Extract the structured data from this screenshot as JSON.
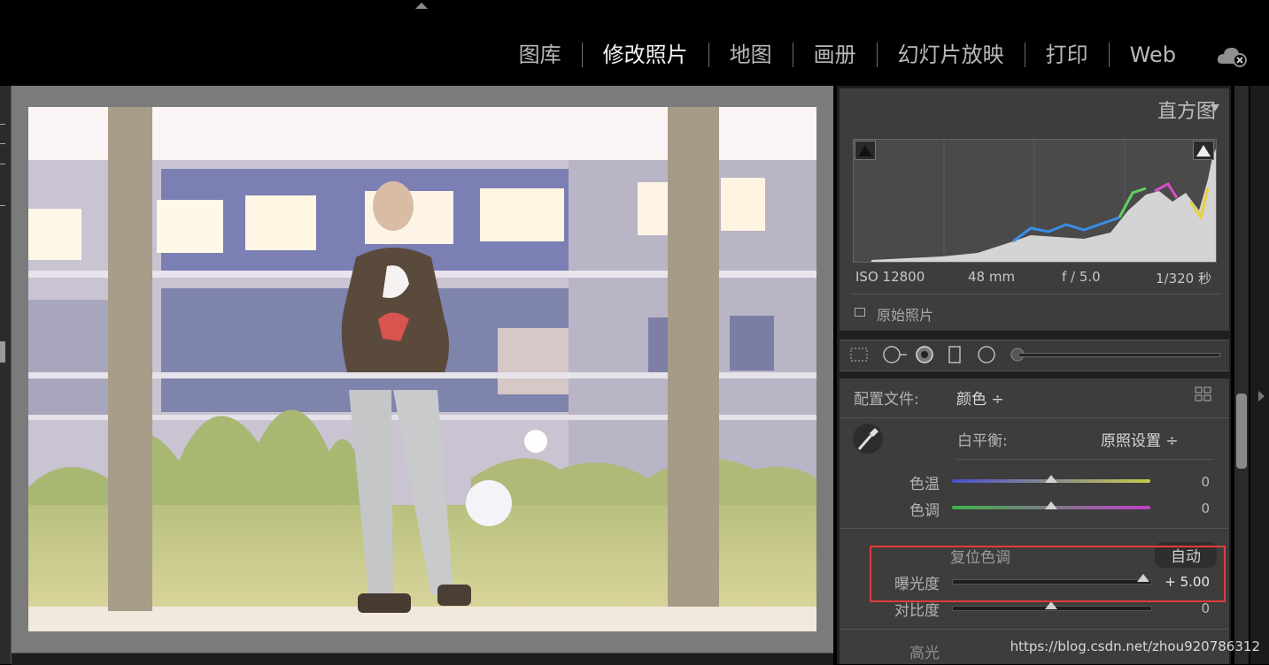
{
  "modules": [
    {
      "label": "图库",
      "active": false
    },
    {
      "label": "修改照片",
      "active": true
    },
    {
      "label": "地图",
      "active": false
    },
    {
      "label": "画册",
      "active": false
    },
    {
      "label": "幻灯片放映",
      "active": false
    },
    {
      "label": "打印",
      "active": false
    },
    {
      "label": "Web",
      "active": false
    }
  ],
  "histogram": {
    "title": "直方图",
    "iso": "ISO 12800",
    "focal": "48 mm",
    "aperture": "f / 5.0",
    "shutter": "1/320 秒",
    "original_label": "原始照片"
  },
  "basic": {
    "profile_label": "配置文件:",
    "profile_value": "颜色 ÷",
    "wb_label": "白平衡:",
    "wb_value": "原照设置 ÷",
    "temp_label": "色温",
    "temp_value": "0",
    "temp_level": 0.5,
    "tint_label": "色调",
    "tint_value": "0",
    "tint_level": 0.5,
    "tone_label": "复位色调",
    "auto_label": "自动",
    "exposure_label": "曝光度",
    "exposure_value": "+ 5.00",
    "exposure_level": 1.0,
    "contrast_label": "对比度",
    "contrast_value": "0",
    "contrast_level": 0.5,
    "next_label": "高光"
  },
  "watermark": "https://blog.csdn.net/zhou920786312",
  "colors": {
    "highlight_box": "#e23a3a"
  }
}
